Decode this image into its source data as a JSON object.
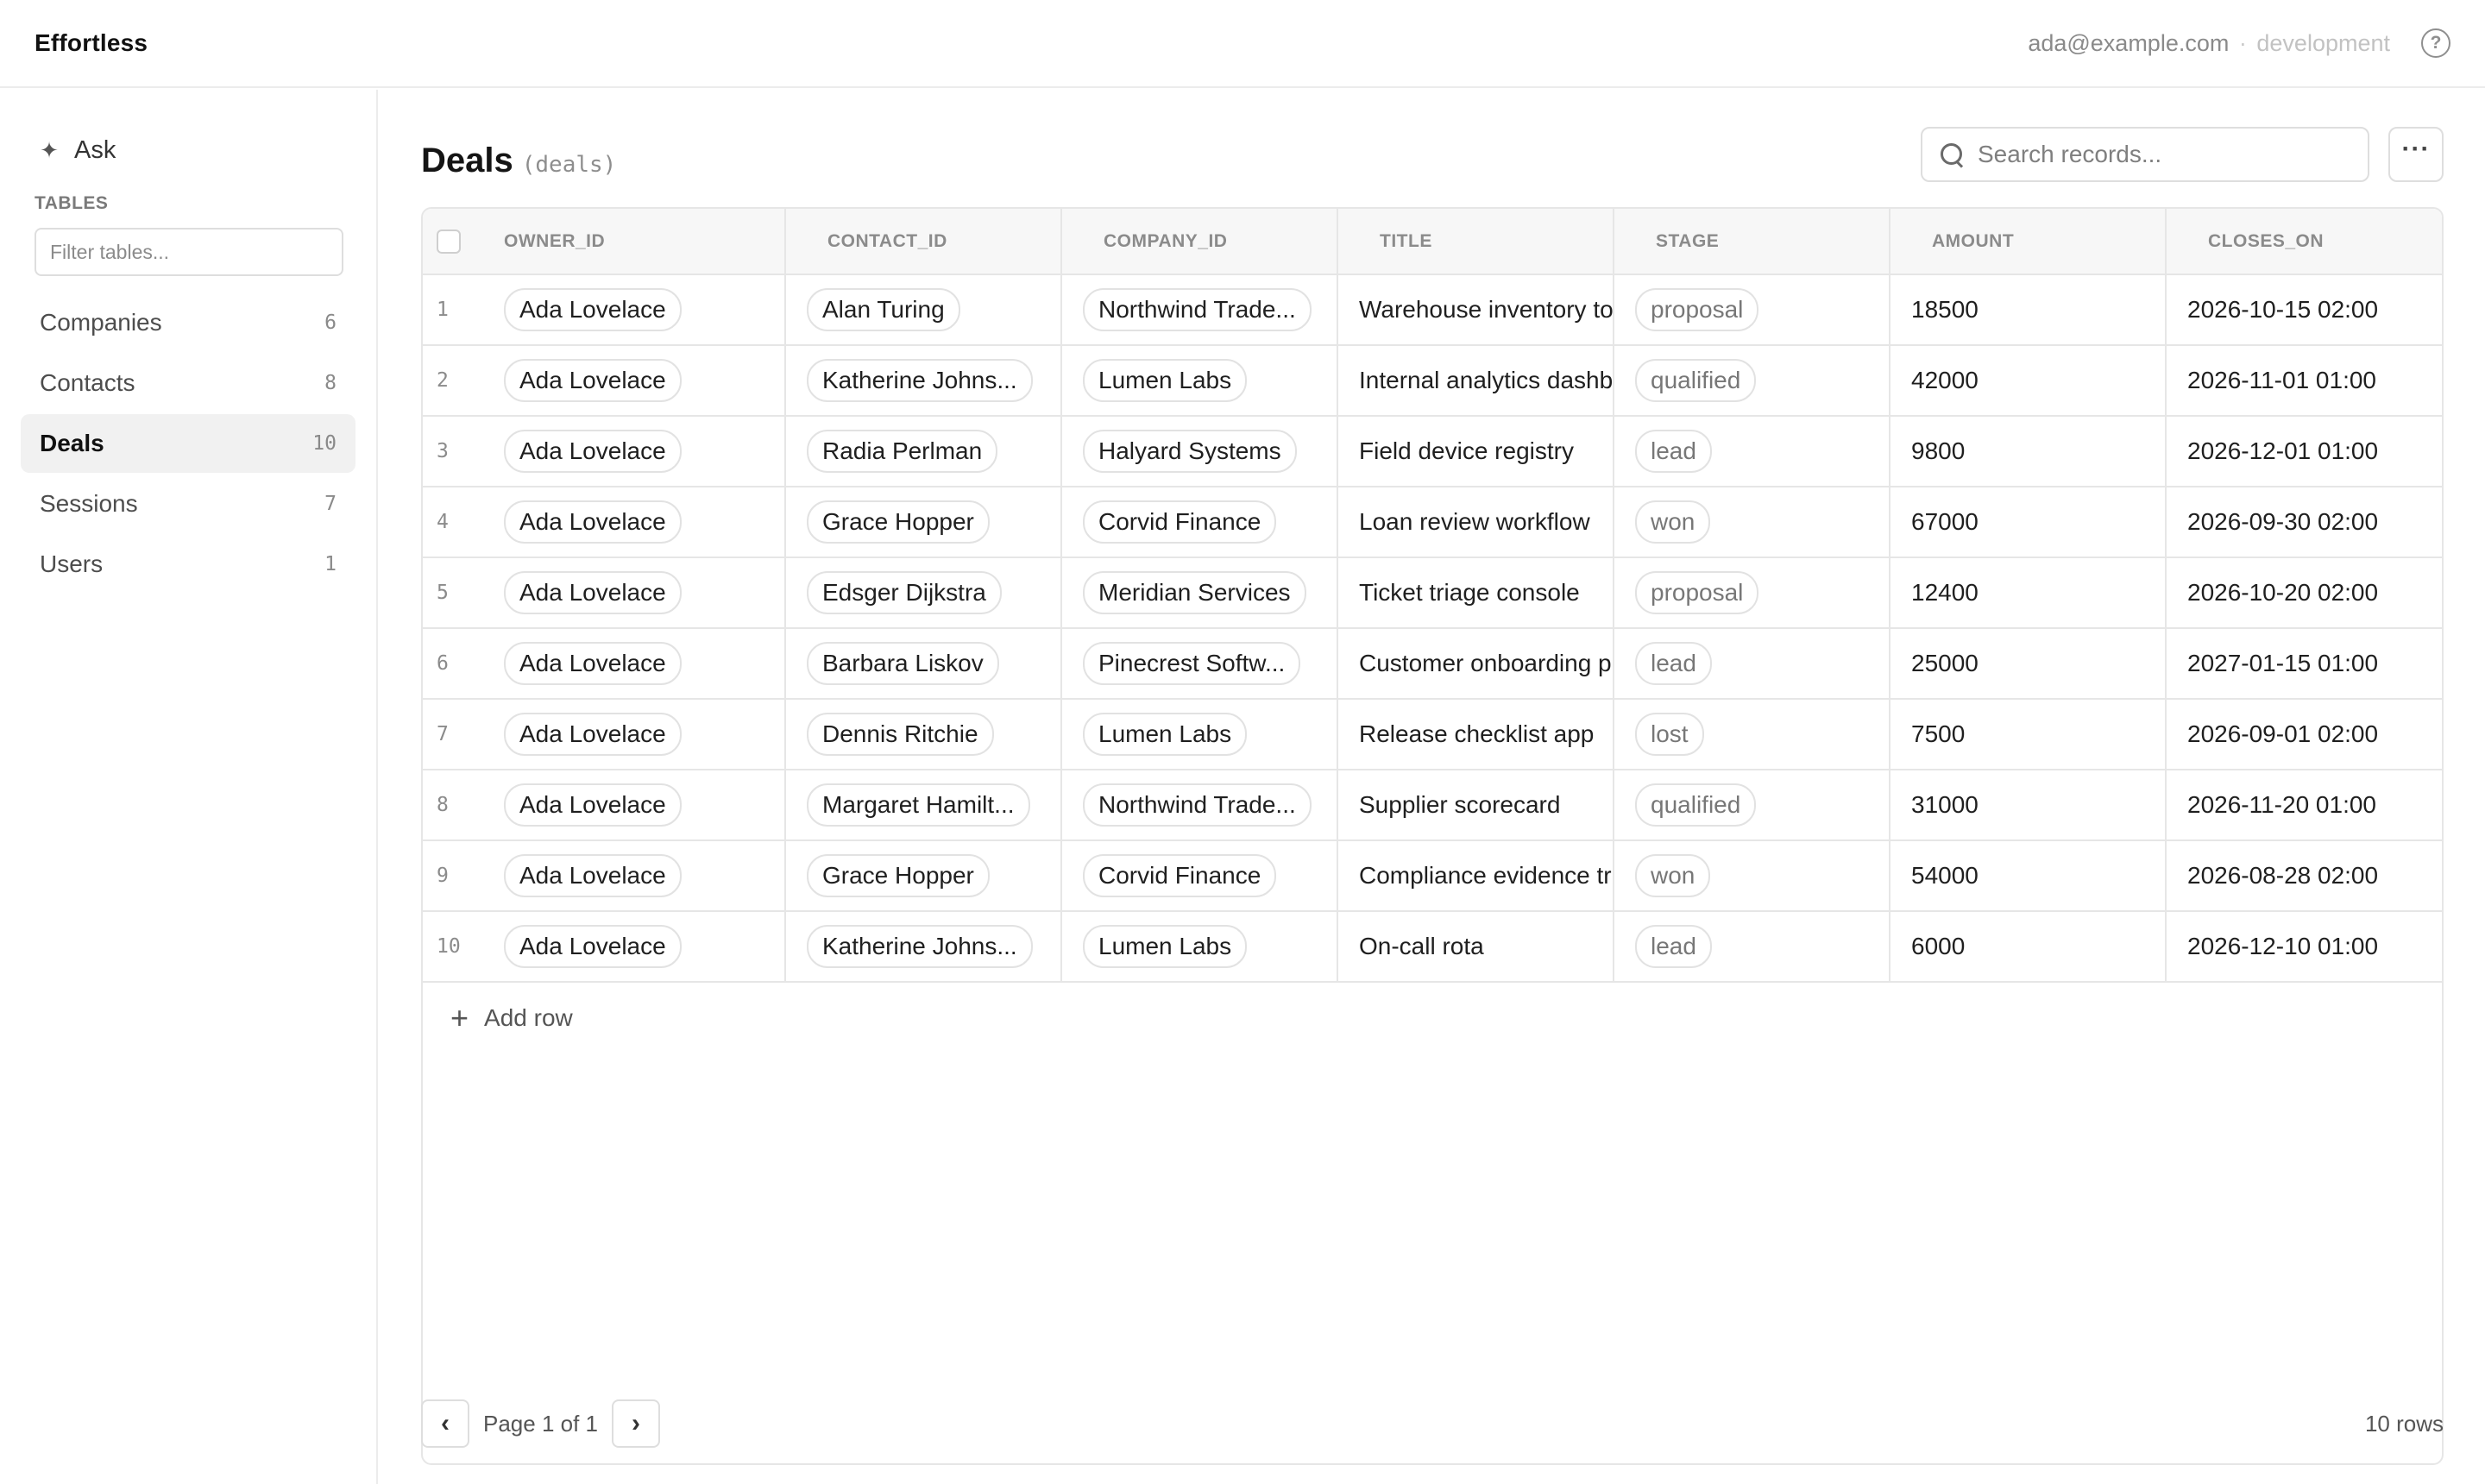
{
  "app": {
    "brand": "Effortless",
    "account_email": "ada@example.com",
    "account_separator": "·",
    "environment": "development",
    "help_icon": "help-circle-icon"
  },
  "sidebar": {
    "ask_icon": "sparkle-icon",
    "ask_label": "Ask",
    "tables_heading": "TABLES",
    "filter_placeholder": "Filter tables...",
    "items": [
      {
        "label": "Companies",
        "count": "6",
        "active": false
      },
      {
        "label": "Contacts",
        "count": "8",
        "active": false
      },
      {
        "label": "Deals",
        "count": "10",
        "active": true
      },
      {
        "label": "Sessions",
        "count": "7",
        "active": false
      },
      {
        "label": "Users",
        "count": "1",
        "active": false
      }
    ]
  },
  "main": {
    "title": "Deals",
    "slug": "(deals)",
    "search_placeholder": "Search records...",
    "more_label": "···"
  },
  "table": {
    "columns": [
      "OWNER_ID",
      "CONTACT_ID",
      "COMPANY_ID",
      "TITLE",
      "STAGE",
      "AMOUNT",
      "CLOSES_ON"
    ],
    "rows": [
      {
        "num": "1",
        "owner": "Ada Lovelace",
        "contact": "Alan Turing",
        "company": "Northwind Trade...",
        "title": "Warehouse inventory to",
        "stage": "proposal",
        "amount": "18500",
        "closes": "2026-10-15 02:00"
      },
      {
        "num": "2",
        "owner": "Ada Lovelace",
        "contact": "Katherine Johns...",
        "company": "Lumen Labs",
        "title": "Internal analytics dashb",
        "stage": "qualified",
        "amount": "42000",
        "closes": "2026-11-01 01:00"
      },
      {
        "num": "3",
        "owner": "Ada Lovelace",
        "contact": "Radia Perlman",
        "company": "Halyard Systems",
        "title": "Field device registry",
        "stage": "lead",
        "amount": "9800",
        "closes": "2026-12-01 01:00"
      },
      {
        "num": "4",
        "owner": "Ada Lovelace",
        "contact": "Grace Hopper",
        "company": "Corvid Finance",
        "title": "Loan review workflow",
        "stage": "won",
        "amount": "67000",
        "closes": "2026-09-30 02:00"
      },
      {
        "num": "5",
        "owner": "Ada Lovelace",
        "contact": "Edsger Dijkstra",
        "company": "Meridian Services",
        "title": "Ticket triage console",
        "stage": "proposal",
        "amount": "12400",
        "closes": "2026-10-20 02:00"
      },
      {
        "num": "6",
        "owner": "Ada Lovelace",
        "contact": "Barbara Liskov",
        "company": "Pinecrest Softw...",
        "title": "Customer onboarding p",
        "stage": "lead",
        "amount": "25000",
        "closes": "2027-01-15 01:00"
      },
      {
        "num": "7",
        "owner": "Ada Lovelace",
        "contact": "Dennis Ritchie",
        "company": "Lumen Labs",
        "title": "Release checklist app",
        "stage": "lost",
        "amount": "7500",
        "closes": "2026-09-01 02:00"
      },
      {
        "num": "8",
        "owner": "Ada Lovelace",
        "contact": "Margaret Hamilt...",
        "company": "Northwind Trade...",
        "title": "Supplier scorecard",
        "stage": "qualified",
        "amount": "31000",
        "closes": "2026-11-20 01:00"
      },
      {
        "num": "9",
        "owner": "Ada Lovelace",
        "contact": "Grace Hopper",
        "company": "Corvid Finance",
        "title": "Compliance evidence tr",
        "stage": "won",
        "amount": "54000",
        "closes": "2026-08-28 02:00"
      },
      {
        "num": "10",
        "owner": "Ada Lovelace",
        "contact": "Katherine Johns...",
        "company": "Lumen Labs",
        "title": "On-call rota",
        "stage": "lead",
        "amount": "6000",
        "closes": "2026-12-10 01:00"
      }
    ],
    "add_row_label": "Add row"
  },
  "footer": {
    "page_text": "Page 1 of 1",
    "row_count": "10 rows",
    "prev_icon": "chevron-left-icon",
    "next_icon": "chevron-right-icon"
  }
}
